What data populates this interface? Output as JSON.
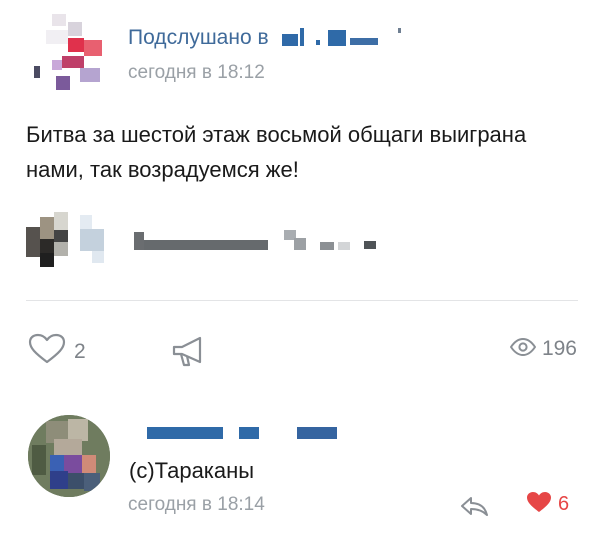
{
  "post": {
    "group_name": "Подслушано в",
    "time": "сегодня в 18:12",
    "text": "Битва за шестой этаж восьмой общаги выиграна нами, так возрадуемся же!",
    "likes": "2",
    "views": "196"
  },
  "comment": {
    "text": "(с)Тараканы",
    "time": "сегодня в 18:14",
    "likes": "6"
  },
  "icons": {
    "like": "heart-outline-icon",
    "share": "megaphone-icon",
    "views": "eye-icon",
    "reply": "reply-arrow-icon",
    "comment_like": "heart-filled-icon"
  },
  "colors": {
    "link": "#3f6a9a",
    "secondary_text": "#9aa0a6",
    "icon_gray": "#7e8389",
    "liked_red": "#e64646"
  }
}
